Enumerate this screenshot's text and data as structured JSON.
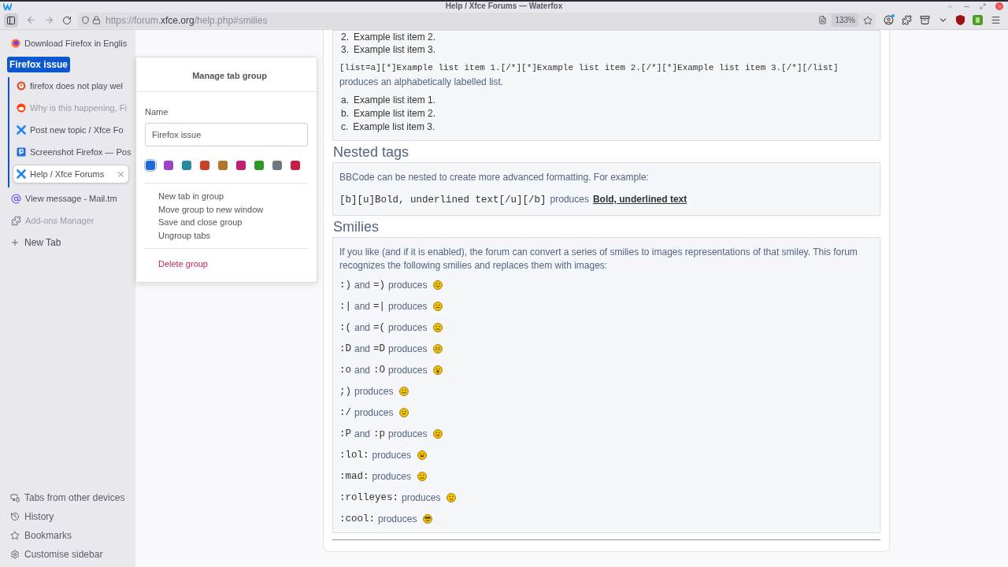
{
  "window": {
    "title": "Help / Xfce Forums — Waterfox"
  },
  "toolbar": {
    "url": {
      "host_prefix": "https://forum.",
      "domain": "xfce.org",
      "path": "/help.php#smilies"
    },
    "zoom": "133%"
  },
  "sidebar": {
    "items": [
      {
        "kind": "firefox",
        "label": "Download Firefox in Englis",
        "unloaded": false,
        "selected": false
      },
      {
        "kind": "group",
        "label": "Firefox issue",
        "color": "#0b57d0",
        "children": [
          {
            "kind": "duck",
            "label": "firefox does not play wel",
            "unloaded": false,
            "selected": false
          },
          {
            "kind": "reddit",
            "label": "Why is this happening, Fi",
            "unloaded": true,
            "selected": false
          },
          {
            "kind": "xfce",
            "label": "Post new topic / Xfce Fo",
            "unloaded": false,
            "selected": false
          },
          {
            "kind": "postimage",
            "label": "Screenshot Firefox — Pos",
            "unloaded": false,
            "selected": false
          },
          {
            "kind": "xfce",
            "label": "Help / Xfce Forums",
            "unloaded": false,
            "selected": true
          }
        ]
      },
      {
        "kind": "mail",
        "label": "View message - Mail.tm",
        "unloaded": false,
        "selected": false
      },
      {
        "kind": "addons",
        "label": "Add-ons Manager",
        "unloaded": true,
        "selected": false
      },
      {
        "kind": "new",
        "label": "New Tab"
      }
    ],
    "footer": [
      {
        "kind": "devices",
        "label": "Tabs from other devices"
      },
      {
        "kind": "history",
        "label": "History"
      },
      {
        "kind": "bookmarks",
        "label": "Bookmarks"
      },
      {
        "kind": "settings",
        "label": "Customise sidebar"
      }
    ]
  },
  "popup": {
    "title": "Manage tab group",
    "name_label": "Name",
    "name_value": "Firefox issue",
    "colors": [
      {
        "color": "#1f6ad6",
        "selected": true
      },
      {
        "color": "#9c45c4",
        "selected": false
      },
      {
        "color": "#268a9c",
        "selected": false
      },
      {
        "color": "#c7422a",
        "selected": false
      },
      {
        "color": "#b0752a",
        "selected": false
      },
      {
        "color": "#c21f6e",
        "selected": false
      },
      {
        "color": "#2a9a2a",
        "selected": false
      },
      {
        "color": "#6e7780",
        "selected": false
      },
      {
        "color": "#c71f4a",
        "selected": false
      }
    ],
    "actions": [
      "New tab in group",
      "Move group to new window",
      "Save and close group",
      "Ungroup tabs"
    ],
    "delete": "Delete group"
  },
  "page": {
    "numbered": [
      {
        "marker": "2.",
        "text": "Example list item 2."
      },
      {
        "marker": "3.",
        "text": "Example list item 3."
      }
    ],
    "alpha_code": "[list=a][*]Example list item 1.[/*][*]Example list item 2.[/*][*]Example list item 3.[/*][/list]",
    "alpha_note": "produces an alphabetically labelled list.",
    "alpha": [
      {
        "marker": "a.",
        "text": "Example list item 1."
      },
      {
        "marker": "b.",
        "text": "Example list item 2."
      },
      {
        "marker": "c.",
        "text": "Example list item 3."
      }
    ],
    "nested_heading": "Nested tags",
    "nested_text": "BBCode can be nested to create more advanced formatting. For example:",
    "nested_code": "[b][u]Bold, underlined text[/u][/b]",
    "nested_produces": "produces",
    "nested_result": "Bold, underlined text",
    "smilies_heading": "Smilies",
    "smilies_text": "If you like (and if it is enabled), the forum can convert a series of smilies to images representations of that smiley. This forum recognizes the following smilies and replaces them with images:",
    "smilies": [
      {
        "parts": [
          {
            "kind": "code",
            "text": ":)"
          },
          {
            "kind": "word",
            "text": "and"
          },
          {
            "kind": "code",
            "text": "=)"
          },
          {
            "kind": "word",
            "text": "produces"
          }
        ],
        "kind": "smile"
      },
      {
        "parts": [
          {
            "kind": "code",
            "text": ":|"
          },
          {
            "kind": "word",
            "text": "and"
          },
          {
            "kind": "code",
            "text": "=|"
          },
          {
            "kind": "word",
            "text": "produces"
          }
        ],
        "kind": "neutral"
      },
      {
        "parts": [
          {
            "kind": "code",
            "text": ":("
          },
          {
            "kind": "word",
            "text": "and"
          },
          {
            "kind": "code",
            "text": "=("
          },
          {
            "kind": "word",
            "text": "produces"
          }
        ],
        "kind": "sad"
      },
      {
        "parts": [
          {
            "kind": "code",
            "text": ":D"
          },
          {
            "kind": "word",
            "text": "and"
          },
          {
            "kind": "code",
            "text": "=D"
          },
          {
            "kind": "word",
            "text": "produces"
          }
        ],
        "kind": "grin"
      },
      {
        "parts": [
          {
            "kind": "code",
            "text": ":o"
          },
          {
            "kind": "word",
            "text": "and"
          },
          {
            "kind": "code",
            "text": ":O"
          },
          {
            "kind": "word",
            "text": "produces"
          }
        ],
        "kind": "surprised"
      },
      {
        "parts": [
          {
            "kind": "code",
            "text": ";)"
          },
          {
            "kind": "word",
            "text": "produces"
          }
        ],
        "kind": "wink"
      },
      {
        "parts": [
          {
            "kind": "code",
            "text": ":/"
          },
          {
            "kind": "word",
            "text": "produces"
          }
        ],
        "kind": "hmm"
      },
      {
        "parts": [
          {
            "kind": "code",
            "text": ":P"
          },
          {
            "kind": "word",
            "text": "and"
          },
          {
            "kind": "code",
            "text": ":p"
          },
          {
            "kind": "word",
            "text": "produces"
          }
        ],
        "kind": "tongue"
      },
      {
        "parts": [
          {
            "kind": "code",
            "text": ":lol:"
          },
          {
            "kind": "word",
            "text": "produces"
          }
        ],
        "kind": "lol"
      },
      {
        "parts": [
          {
            "kind": "code",
            "text": ":mad:"
          },
          {
            "kind": "word",
            "text": "produces"
          }
        ],
        "kind": "mad"
      },
      {
        "parts": [
          {
            "kind": "code",
            "text": ":rolleyes:"
          },
          {
            "kind": "word",
            "text": "produces"
          }
        ],
        "kind": "rolleyes"
      },
      {
        "parts": [
          {
            "kind": "code",
            "text": ":cool:"
          },
          {
            "kind": "word",
            "text": "produces"
          }
        ],
        "kind": "cool"
      }
    ]
  }
}
